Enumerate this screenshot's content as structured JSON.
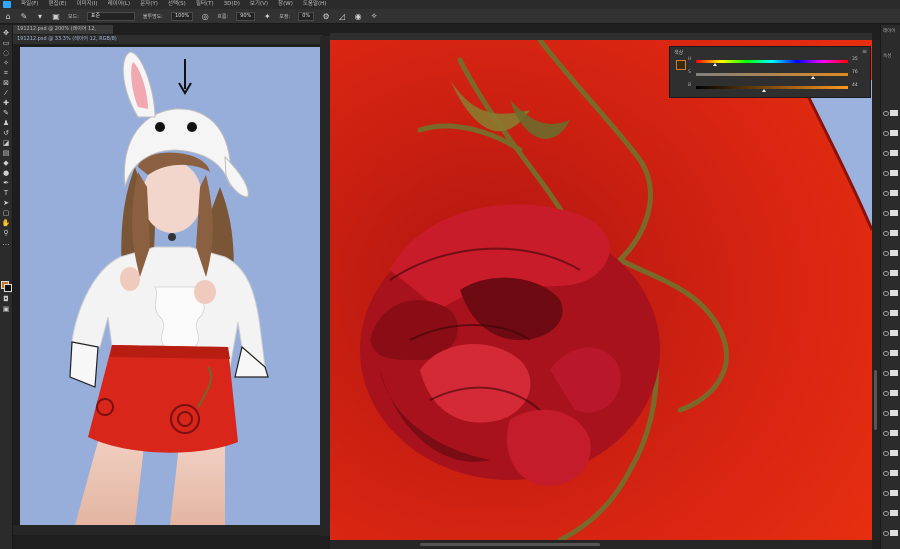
{
  "menubar": {
    "items": [
      "파일(F)",
      "편집(E)",
      "이미지(I)",
      "레이어(L)",
      "문자(Y)",
      "선택(S)",
      "필터(T)",
      "3D(D)",
      "보기(V)",
      "창(W)",
      "도움말(H)"
    ]
  },
  "options": {
    "brush_mode_label": "모드:",
    "brush_mode_value": "표준",
    "opacity_label": "불투명도:",
    "opacity_value": "100%",
    "flow_label": "흐름:",
    "flow_value": "90%",
    "smoothing_label": "보정:",
    "smoothing_value": "0%"
  },
  "tabs": {
    "main_label": "191212.psd @ 200% (레이어 12, RGB/8)",
    "close_glyph": "×",
    "second_label": "191212.psd @ 33.3% (레이어 12, RGB/8)"
  },
  "color_panel": {
    "title": "색상",
    "menu_glyph": "≡",
    "rows": [
      {
        "label": "H",
        "value": "35"
      },
      {
        "label": "S",
        "value": "76"
      },
      {
        "label": "B",
        "value": "44"
      }
    ]
  },
  "right_panel": {
    "label_top": "레이어",
    "label_second": "속성"
  },
  "icons": {
    "home": "home-icon",
    "brush": "brush-icon",
    "arrow_annotation": "arrow-down-icon"
  },
  "colors": {
    "skirt_red": "#d8261a",
    "canvas_blue": "#97aedb",
    "zoom_red": "#c81f10",
    "foreground_swatch": "#c8731f"
  }
}
